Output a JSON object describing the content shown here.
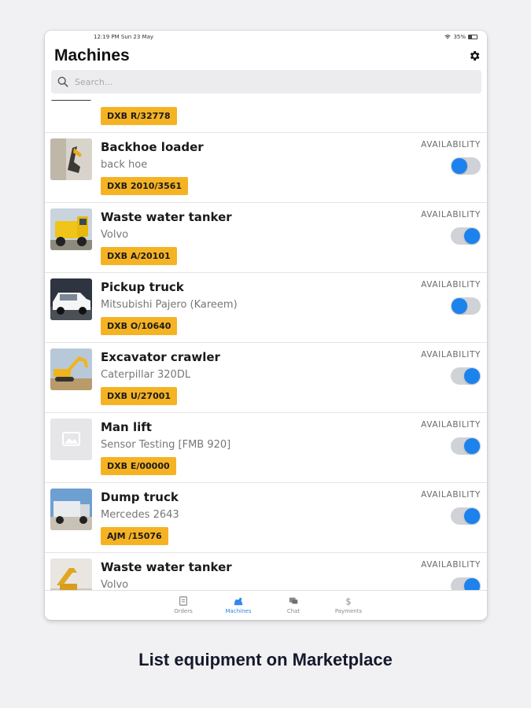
{
  "status": {
    "time": "12:19 PM  Sun 23 May",
    "battery": "35%",
    "battery_level": 0.35
  },
  "header": {
    "title": "Machines"
  },
  "search": {
    "placeholder": "Search..."
  },
  "availability_label": "AVAILABILITY",
  "colors": {
    "accent": "#1b82ee",
    "plate": "#f5b324"
  },
  "rows": [
    {
      "name": "",
      "sub": "",
      "plate": "DXB R/32778",
      "available": false
    },
    {
      "name": "Backhoe loader",
      "sub": "back hoe",
      "plate": "DXB 2010/3561",
      "available": false
    },
    {
      "name": "Waste water tanker",
      "sub": "Volvo",
      "plate": "DXB A/20101",
      "available": true
    },
    {
      "name": "Pickup truck",
      "sub": "Mitsubishi Pajero (Kareem)",
      "plate": "DXB O/10640",
      "available": false
    },
    {
      "name": "Excavator crawler",
      "sub": "Caterpillar 320DL",
      "plate": "DXB U/27001",
      "available": true
    },
    {
      "name": "Man lift",
      "sub": "Sensor Testing [FMB 920]",
      "plate": "DXB E/00000",
      "available": true
    },
    {
      "name": "Dump truck",
      "sub": "Mercedes 2643",
      "plate": "AJM /15076",
      "available": true
    },
    {
      "name": "Waste water tanker",
      "sub": "Volvo",
      "plate": "",
      "available": true
    }
  ],
  "tabs": [
    {
      "label": "Orders",
      "icon": "orders-icon"
    },
    {
      "label": "Machines",
      "icon": "machines-icon"
    },
    {
      "label": "Chat",
      "icon": "chat-icon"
    },
    {
      "label": "Payments",
      "icon": "dollar-icon"
    }
  ],
  "caption": "List equipment on Marketplace"
}
